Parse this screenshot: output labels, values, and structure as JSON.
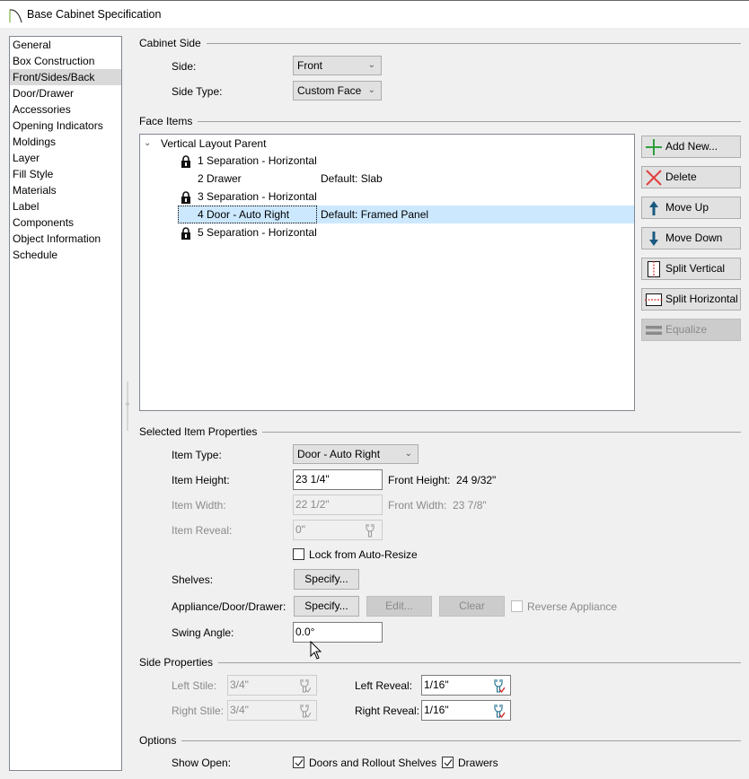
{
  "window": {
    "title": "Base Cabinet Specification",
    "icon": "arch-icon"
  },
  "nav": {
    "items": [
      {
        "label": "General",
        "selected": false
      },
      {
        "label": "Box Construction",
        "selected": false
      },
      {
        "label": "Front/Sides/Back",
        "selected": true
      },
      {
        "label": "Door/Drawer",
        "selected": false
      },
      {
        "label": "Accessories",
        "selected": false
      },
      {
        "label": "Opening Indicators",
        "selected": false
      },
      {
        "label": "Moldings",
        "selected": false
      },
      {
        "label": "Layer",
        "selected": false
      },
      {
        "label": "Fill Style",
        "selected": false
      },
      {
        "label": "Materials",
        "selected": false
      },
      {
        "label": "Label",
        "selected": false
      },
      {
        "label": "Components",
        "selected": false
      },
      {
        "label": "Object Information",
        "selected": false
      },
      {
        "label": "Schedule",
        "selected": false
      }
    ]
  },
  "cabinet_side": {
    "group_label": "Cabinet Side",
    "side_label": "Side:",
    "side_value": "Front",
    "side_type_label": "Side Type:",
    "side_type_value": "Custom Face"
  },
  "face_items": {
    "group_label": "Face Items",
    "root": "Vertical Layout Parent",
    "items": [
      {
        "name": "1 Separation - Horizontal",
        "detail": "",
        "locked": true,
        "selected": false
      },
      {
        "name": "2 Drawer",
        "detail": "Default: Slab",
        "locked": false,
        "selected": false
      },
      {
        "name": "3 Separation - Horizontal",
        "detail": "",
        "locked": true,
        "selected": false
      },
      {
        "name": "4 Door - Auto Right",
        "detail": "Default: Framed Panel",
        "locked": false,
        "selected": true
      },
      {
        "name": "5 Separation - Horizontal",
        "detail": "",
        "locked": true,
        "selected": false
      }
    ],
    "buttons": {
      "add_new": "Add New...",
      "delete": "Delete",
      "move_up": "Move Up",
      "move_down": "Move Down",
      "split_vertical": "Split Vertical",
      "split_horizontal": "Split Horizontal",
      "equalize": "Equalize"
    }
  },
  "selected_item": {
    "group_label": "Selected Item Properties",
    "item_type_label": "Item Type:",
    "item_type_value": "Door - Auto Right",
    "item_height_label": "Item Height:",
    "item_height_value": "23 1/4\"",
    "front_height_label": "Front Height:",
    "front_height_value": "24 9/32\"",
    "item_width_label": "Item Width:",
    "item_width_value": "22 1/2\"",
    "front_width_label": "Front Width:",
    "front_width_value": "23 7/8\"",
    "item_reveal_label": "Item Reveal:",
    "item_reveal_value": "0\"",
    "lock_auto_resize_label": "Lock from Auto-Resize",
    "lock_auto_resize_checked": false,
    "shelves_label": "Shelves:",
    "shelves_specify": "Specify...",
    "appliance_label": "Appliance/Door/Drawer:",
    "appliance_specify": "Specify...",
    "appliance_edit": "Edit...",
    "appliance_clear": "Clear",
    "reverse_appliance_label": "Reverse Appliance",
    "reverse_appliance_checked": false,
    "swing_angle_label": "Swing Angle:",
    "swing_angle_value": "0.0°"
  },
  "side_properties": {
    "group_label": "Side Properties",
    "left_stile_label": "Left Stile:",
    "left_stile_value": "3/4\"",
    "right_stile_label": "Right Stile:",
    "right_stile_value": "3/4\"",
    "left_reveal_label": "Left Reveal:",
    "left_reveal_value": "1/16\"",
    "right_reveal_label": "Right Reveal:",
    "right_reveal_value": "1/16\""
  },
  "options": {
    "group_label": "Options",
    "show_open_label": "Show Open:",
    "doors_rollout_label": "Doors and Rollout Shelves",
    "doors_rollout_checked": true,
    "drawers_label": "Drawers",
    "drawers_checked": true
  },
  "colors": {
    "selection": "#cce8ff",
    "nav_selection": "#d9d9d9",
    "add_green": "#2e9e3e",
    "delete_red": "#e04040",
    "arrow_blue": "#1a5a80"
  }
}
